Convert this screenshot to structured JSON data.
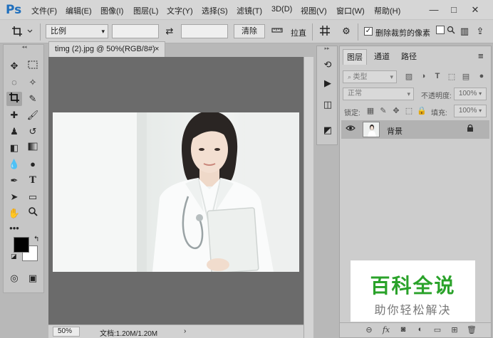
{
  "app": {
    "logo": "Ps",
    "menu": [
      "文件(F)",
      "编辑(E)",
      "图像(I)",
      "图层(L)",
      "文字(Y)",
      "选择(S)",
      "滤镜(T)",
      "3D(D)",
      "视图(V)",
      "窗口(W)",
      "帮助(H)"
    ],
    "window_controls": {
      "minimize": "—",
      "restore": "□",
      "close": "✕"
    }
  },
  "options_bar": {
    "ratio_select": "比例",
    "clear_button": "清除",
    "straighten_label": "拉直",
    "delete_pixels_label": "删除裁剪的像素",
    "delete_pixels_checked": true,
    "checkbox_mark": "✓"
  },
  "document": {
    "tab_title": "timg (2).jpg @ 50%(RGB/8#)",
    "close_glyph": "×",
    "zoom": "50%",
    "doc_info": "文档:1.20M/1.20M",
    "status_arrow": "›"
  },
  "layers_panel": {
    "tabs": [
      "图层",
      "通道",
      "路径"
    ],
    "active_tab": 0,
    "menu_glyph": "≡",
    "filter_kind": "类型",
    "blend_mode": "正常",
    "opacity_label": "不透明度:",
    "opacity_value": "100%",
    "lock_label": "锁定:",
    "fill_label": "填充:",
    "fill_value": "100%",
    "layers": [
      {
        "name": "背景",
        "visible": true,
        "locked": true
      }
    ]
  },
  "watermark": {
    "title": "百科全说",
    "subtitle": "助你轻松解决"
  },
  "colors": {
    "foreground": "#000000",
    "background": "#ffffff",
    "watermark_green": "#2aa22a"
  }
}
